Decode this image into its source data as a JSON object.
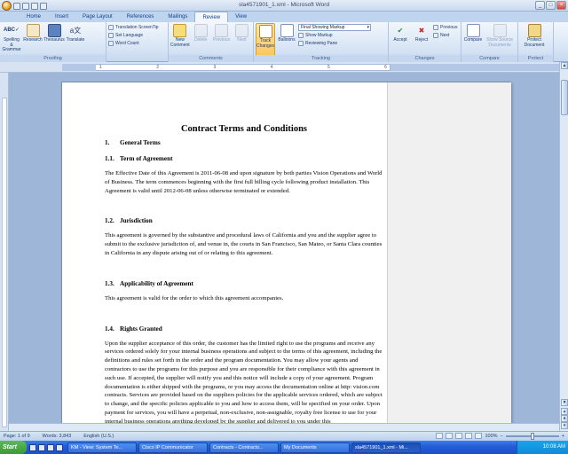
{
  "window": {
    "title": "sla4571901_1.xml - Microsoft Word"
  },
  "tabs": [
    "Home",
    "Insert",
    "Page Layout",
    "References",
    "Mailings",
    "Review",
    "View"
  ],
  "active_tab": "Review",
  "ribbon": {
    "proofing": {
      "label": "Proofing",
      "spelling": "Spelling & Grammar",
      "research": "Research",
      "thesaurus": "Thesaurus",
      "translate": "Translate",
      "screentip": "Translation ScreenTip",
      "set_language": "Set Language",
      "word_count": "Word Count"
    },
    "comments": {
      "label": "Comments",
      "new": "New Comment",
      "delete": "Delete",
      "previous": "Previous",
      "next": "Next"
    },
    "tracking": {
      "label": "Tracking",
      "track_changes": "Track Changes",
      "balloons": "Balloons",
      "markup_select": "Final Showing Markup",
      "show_markup": "Show Markup",
      "reviewing_pane": "Reviewing Pane"
    },
    "changes": {
      "label": "Changes",
      "accept": "Accept",
      "reject": "Reject",
      "previous": "Previous",
      "next": "Next"
    },
    "compare": {
      "label": "Compare",
      "compare": "Compare",
      "show_source": "Show Source Documents"
    },
    "protect": {
      "label": "Protect",
      "protect_doc": "Protect Document"
    }
  },
  "document": {
    "title": "Contract Terms and Conditions",
    "sections": [
      {
        "num": "1.",
        "heading": "General Terms"
      },
      {
        "num": "1.1.",
        "heading": "Term of Agreement",
        "text": "The Effective Date of this Agreement is 2011-06-08 and upon signature by both parties Vision Operations and World of Business. The term commences beginning with the first full billing cycle following product installation. This Agreement is valid until 2012-06-08 unless otherwise terminated or extended."
      },
      {
        "num": "1.2.",
        "heading": "Jurisdiction",
        "text": "This agreement is governed by the substantive and procedural laws of California and you and the supplier agree to submit to the exclusive jurisdiction of, and venue in, the courts in San Francisco, San Mateo, or Santa Clara counties in California in any dispute arising out of or relating to this agreement."
      },
      {
        "num": "1.3.",
        "heading": "Applicability of Agreement",
        "text": "This agreement is valid for the order to which this agreement accompanies."
      },
      {
        "num": "1.4.",
        "heading": "Rights Granted",
        "text": "Upon the supplier acceptance of this order, the customer has the limited right to use the programs and receive any services ordered solely for your internal business operations and subject to the terms of this agreement, including the definitions and rules set forth in the order and the program documentation. You may allow your agents and contractors to use the programs for this purpose and you are responsible for their compliance with this agreement in such use. If accepted, the supplier will notify you and this notice will include a copy of your agreement. Program documentation is either shipped with the programs, or you may access the documentation online at http: vision.com contracts. Services are provided based on the suppliers policies for the applicable services ordered, which are subject to change, and the specific policies applicable to you and how to access them, will be specified on your order. Upon payment for services, you will have a perpetual, non-exclusive, non-assignable, royalty free license to use for your internal business operations anything developed by the supplier and delivered to you under this"
      }
    ]
  },
  "status": {
    "page": "Page: 1 of 9",
    "words": "Words: 3,843",
    "language": "English (U.S.)",
    "zoom": "100%"
  },
  "taskbar": {
    "start": "Start",
    "tasks": [
      "KM - View: System Te...",
      "Cisco IP Communicator",
      "Contracts - Contracts...",
      "My Documents",
      "sla4571901_1.xml - Mi..."
    ],
    "active_task": 4,
    "clock": "10:08 AM"
  }
}
